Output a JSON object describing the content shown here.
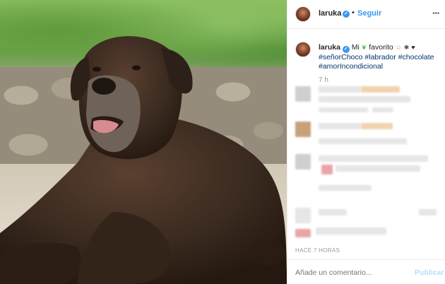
{
  "header": {
    "username": "laruka",
    "separator": "•",
    "follow_label": "Seguir",
    "more_label": "···"
  },
  "caption": {
    "username": "laruka",
    "text_before": "Mi",
    "text_after": "favorito",
    "hashtags": [
      "#señorChoco",
      "#labrador",
      "#chocolate",
      "#amorIncondicional"
    ],
    "emojis": [
      "verified-icon",
      "emoji-leaf",
      "emoji-smile",
      "emoji-paw",
      "emoji-heart"
    ]
  },
  "post_age": "7 h",
  "timestamp": "HACE 7 HORAS",
  "comment_box": {
    "placeholder": "Añade un comentario...",
    "publish_label": "Publicar"
  },
  "colors": {
    "accent": "#3897f0",
    "publish_disabled": "#b2dffc",
    "muted": "#999999",
    "hashtag": "#003569"
  }
}
